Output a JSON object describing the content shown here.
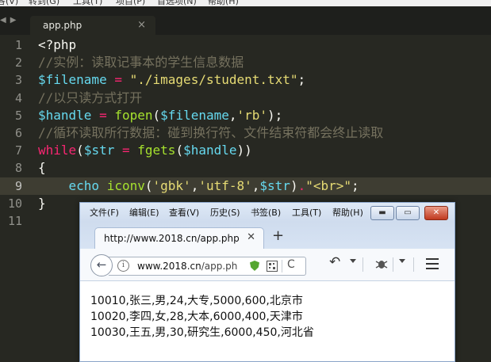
{
  "editor": {
    "menu": [
      "各(V)",
      "转到(G)",
      "工具(T)",
      "项目(P)",
      "首选项(N)",
      "帮助(H)"
    ],
    "tab": {
      "title": "app.php",
      "close": "×"
    },
    "nav_left": "◀",
    "nav_right": "▶",
    "current_line": 9,
    "lines": [
      {
        "n": "1",
        "tokens": [
          {
            "t": "<?php",
            "c": "plain"
          }
        ]
      },
      {
        "n": "2",
        "tokens": [
          {
            "t": "//实例：读取记事本的学生信息数据",
            "c": "comment"
          }
        ]
      },
      {
        "n": "3",
        "tokens": [
          {
            "t": "$filename",
            "c": "var"
          },
          {
            "t": " ",
            "c": "plain"
          },
          {
            "t": "=",
            "c": "op"
          },
          {
            "t": " ",
            "c": "plain"
          },
          {
            "t": "\"./images/student.txt\"",
            "c": "str"
          },
          {
            "t": ";",
            "c": "plain"
          }
        ]
      },
      {
        "n": "4",
        "tokens": [
          {
            "t": "//以只读方式打开",
            "c": "comment"
          }
        ]
      },
      {
        "n": "5",
        "tokens": [
          {
            "t": "$handle",
            "c": "var"
          },
          {
            "t": " ",
            "c": "plain"
          },
          {
            "t": "=",
            "c": "op"
          },
          {
            "t": " ",
            "c": "plain"
          },
          {
            "t": "fopen",
            "c": "fn"
          },
          {
            "t": "(",
            "c": "plain"
          },
          {
            "t": "$filename",
            "c": "var"
          },
          {
            "t": ",",
            "c": "plain"
          },
          {
            "t": "'rb'",
            "c": "str"
          },
          {
            "t": ");",
            "c": "plain"
          }
        ]
      },
      {
        "n": "6",
        "tokens": [
          {
            "t": "//循环读取所行数据：碰到换行符、文件结束符都会终止读取",
            "c": "comment"
          }
        ]
      },
      {
        "n": "7",
        "tokens": [
          {
            "t": "while",
            "c": "kw"
          },
          {
            "t": "(",
            "c": "plain"
          },
          {
            "t": "$str",
            "c": "var"
          },
          {
            "t": " ",
            "c": "plain"
          },
          {
            "t": "=",
            "c": "op"
          },
          {
            "t": " ",
            "c": "plain"
          },
          {
            "t": "fgets",
            "c": "fn"
          },
          {
            "t": "(",
            "c": "plain"
          },
          {
            "t": "$handle",
            "c": "var"
          },
          {
            "t": "))",
            "c": "plain"
          }
        ]
      },
      {
        "n": "8",
        "tokens": [
          {
            "t": "{",
            "c": "plain"
          }
        ]
      },
      {
        "n": "9",
        "tokens": [
          {
            "t": "    ",
            "c": "plain"
          },
          {
            "t": "echo",
            "c": "builtin"
          },
          {
            "t": " ",
            "c": "plain"
          },
          {
            "t": "iconv",
            "c": "fn"
          },
          {
            "t": "(",
            "c": "plain"
          },
          {
            "t": "'gbk'",
            "c": "str"
          },
          {
            "t": ",",
            "c": "plain"
          },
          {
            "t": "'utf-8'",
            "c": "str"
          },
          {
            "t": ",",
            "c": "plain"
          },
          {
            "t": "$str",
            "c": "var"
          },
          {
            "t": ")",
            "c": "plain"
          },
          {
            "t": ".",
            "c": "op"
          },
          {
            "t": "\"<br>\"",
            "c": "str"
          },
          {
            "t": ";",
            "c": "plain"
          }
        ]
      },
      {
        "n": "10",
        "tokens": [
          {
            "t": "}",
            "c": "plain"
          }
        ]
      },
      {
        "n": "11",
        "tokens": []
      }
    ]
  },
  "browser": {
    "menu": [
      "文件(F)",
      "编辑(E)",
      "查看(V)",
      "历史(S)",
      "书签(B)",
      "工具(T)",
      "帮助(H)"
    ],
    "window_buttons": {
      "minimize": "▬",
      "maximize": "▭",
      "close": "✕"
    },
    "tab": {
      "title": "http://www.2018.cn/app.php",
      "close": "✕"
    },
    "new_tab": "+",
    "back": "←",
    "info": "i",
    "url": {
      "host": "www.2018.cn",
      "path": "/app.php"
    },
    "reload": "C",
    "undo": "↶",
    "output": [
      "10010,张三,男,24,大专,5000,600,北京市",
      "10020,李四,女,28,大本,6000,400,天津市",
      "10030,王五,男,30,研究生,6000,450,河北省"
    ]
  }
}
